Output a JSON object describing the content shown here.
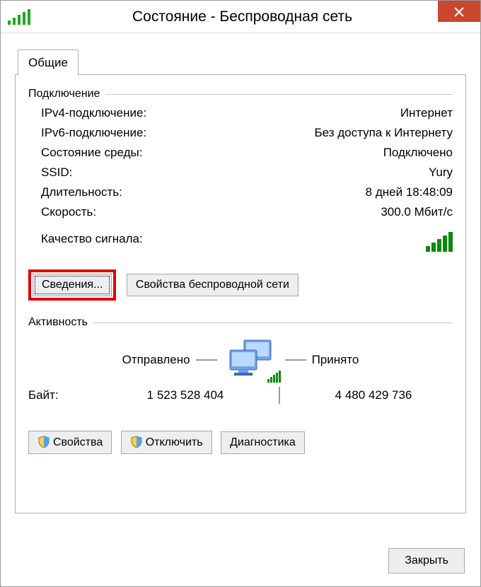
{
  "window": {
    "title": "Состояние - Беспроводная сеть"
  },
  "tab": {
    "general": "Общие"
  },
  "connection": {
    "title": "Подключение",
    "ipv4_lbl": "IPv4-подключение:",
    "ipv4_val": "Интернет",
    "ipv6_lbl": "IPv6-подключение:",
    "ipv6_val": "Без доступа к Интернету",
    "media_lbl": "Состояние среды:",
    "media_val": "Подключено",
    "ssid_lbl": "SSID:",
    "ssid_val": "Yury",
    "dur_lbl": "Длительность:",
    "dur_val": "8 дней 18:48:09",
    "speed_lbl": "Скорость:",
    "speed_val": "300.0 Мбит/с",
    "signal_lbl": "Качество сигнала:"
  },
  "buttons": {
    "details": "Сведения...",
    "wprops": "Свойства беспроводной сети",
    "props": "Свойства",
    "disable": "Отключить",
    "diag": "Диагностика",
    "close": "Закрыть"
  },
  "activity": {
    "title": "Активность",
    "sent_lbl": "Отправлено",
    "recv_lbl": "Принято",
    "bytes_lbl": "Байт:",
    "sent_val": "1 523 528 404",
    "recv_val": "4 480 429 736"
  }
}
